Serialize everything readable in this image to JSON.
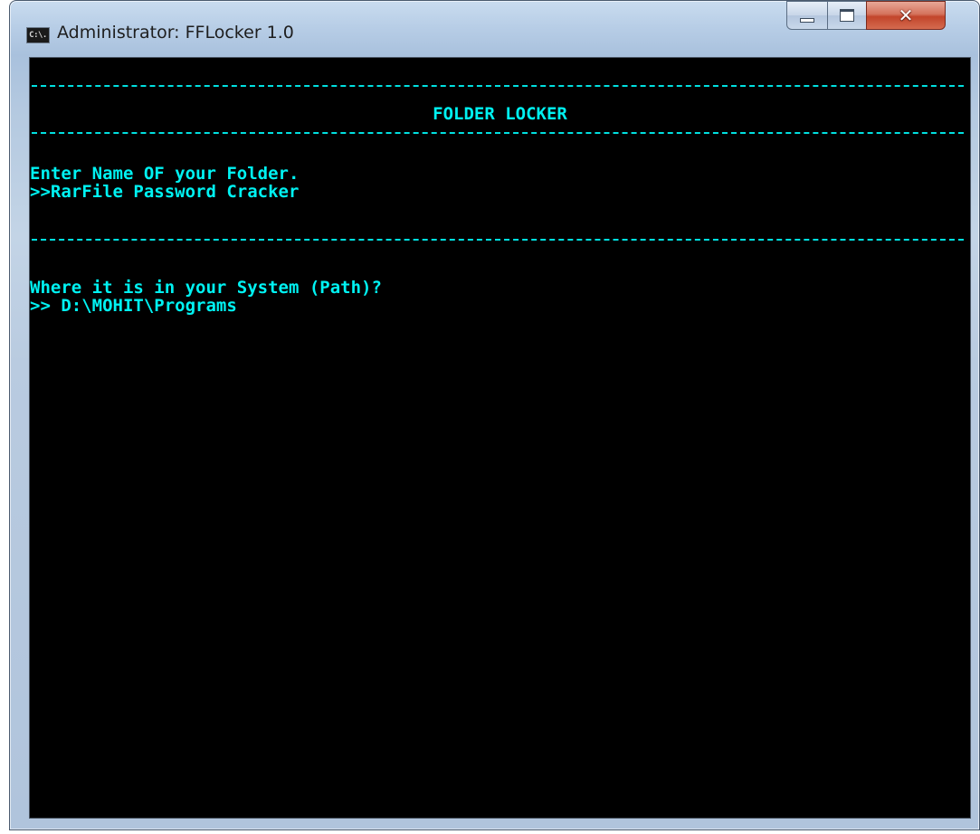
{
  "window": {
    "title": "Administrator: FFLocker 1.0",
    "app_icon_text": "C:\\.",
    "controls": {
      "minimize": "minimize-icon",
      "maximize": "maximize-icon",
      "close": "close-icon"
    }
  },
  "console": {
    "colors": {
      "background": "#000000",
      "text": "#00f2f2"
    },
    "heading": "FOLDER LOCKER",
    "prompt1": "Enter Name OF your Folder.",
    "answer1": ">>RarFile Password Cracker",
    "prompt2": "Where it is in your System (Path)?",
    "answer2": ">> D:\\MOHIT\\Programs"
  }
}
